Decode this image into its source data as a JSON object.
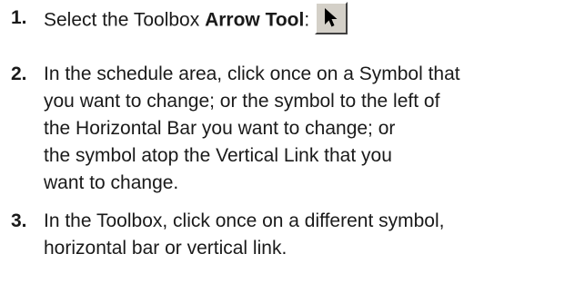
{
  "steps": [
    {
      "number": "1.",
      "text_before": "Select the Toolbox ",
      "bold_text": "Arrow Tool",
      "text_after": ":",
      "icon": "arrow-cursor-icon"
    },
    {
      "number": "2.",
      "lines": [
        "In the schedule area, click once on a Symbol that",
        "you want to change; or the symbol to the left of",
        "the Horizontal Bar you want to change; or",
        "the symbol atop the Vertical Link that you",
        "want to change."
      ]
    },
    {
      "number": "3.",
      "lines": [
        "In the Toolbox, click once on a different symbol,",
        "horizontal bar or vertical link."
      ]
    }
  ]
}
